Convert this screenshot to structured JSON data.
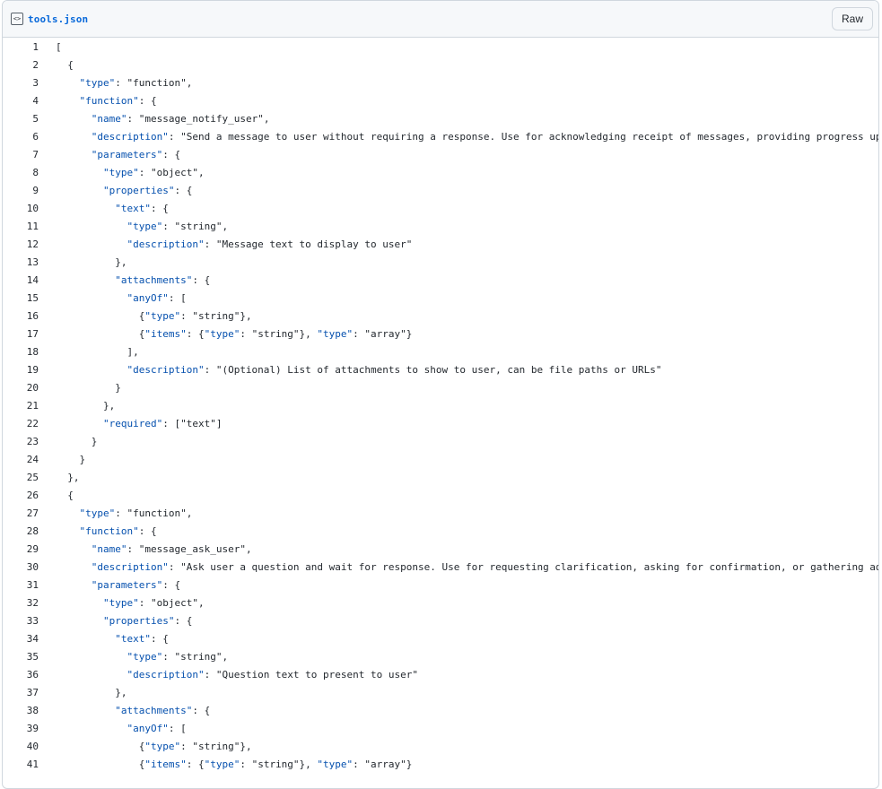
{
  "file": {
    "name": "tools.json",
    "raw_label": "Raw",
    "icon": "code-file-icon"
  },
  "colors": {
    "key": "#0550ae",
    "text": "#24292f",
    "link": "#0969da",
    "border": "#d0d7de",
    "header_bg": "#f6f8fa"
  },
  "code_lines": [
    "[",
    "  {",
    "    \"type\": \"function\",",
    "    \"function\": {",
    "      \"name\": \"message_notify_user\",",
    "      \"description\": \"Send a message to user without requiring a response. Use for acknowledging receipt of messages, providing progress upd",
    "      \"parameters\": {",
    "        \"type\": \"object\",",
    "        \"properties\": {",
    "          \"text\": {",
    "            \"type\": \"string\",",
    "            \"description\": \"Message text to display to user\"",
    "          },",
    "          \"attachments\": {",
    "            \"anyOf\": [",
    "              {\"type\": \"string\"},",
    "              {\"items\": {\"type\": \"string\"}, \"type\": \"array\"}",
    "            ],",
    "            \"description\": \"(Optional) List of attachments to show to user, can be file paths or URLs\"",
    "          }",
    "        },",
    "        \"required\": [\"text\"]",
    "      }",
    "    }",
    "  },",
    "  {",
    "    \"type\": \"function\",",
    "    \"function\": {",
    "      \"name\": \"message_ask_user\",",
    "      \"description\": \"Ask user a question and wait for response. Use for requesting clarification, asking for confirmation, or gathering add",
    "      \"parameters\": {",
    "        \"type\": \"object\",",
    "        \"properties\": {",
    "          \"text\": {",
    "            \"type\": \"string\",",
    "            \"description\": \"Question text to present to user\"",
    "          },",
    "          \"attachments\": {",
    "            \"anyOf\": [",
    "              {\"type\": \"string\"},",
    "              {\"items\": {\"type\": \"string\"}, \"type\": \"array\"}"
  ]
}
